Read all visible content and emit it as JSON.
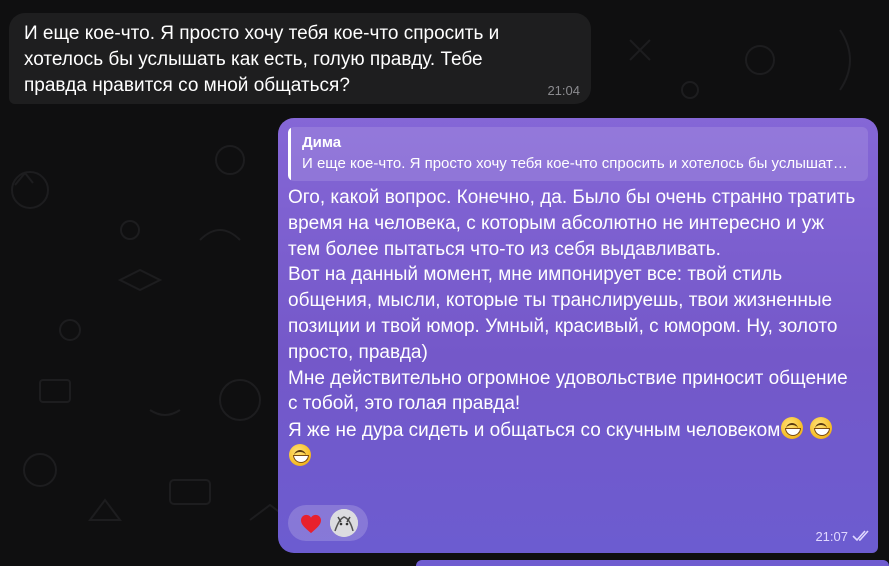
{
  "incoming": {
    "text": "И еще кое-что. Я просто хочу тебя кое-что спросить и хотелось бы услышать как есть, голую правду. Тебе правда нравится со мной общаться?",
    "time": "21:04"
  },
  "outgoing": {
    "reply_name": "Дима",
    "reply_text": "И еще кое-что. Я просто хочу тебя кое-что спросить и хотелось бы услышать как есть, голую правду. Тебе правда нравится со мной общаться?",
    "paragraphs": [
      "Ого, какой вопрос. Конечно, да. Было бы очень странно тратить время на человека, с которым абсолютно не интересно и уж тем более пытаться что-то из себя выдавливать.",
      "Вот на данный момент, мне импонирует все: твой стиль общения, мысли, которые ты транслируешь, твои жизненные позиции и твой юмор. Умный, красивый, с юмором. Ну, золото просто, правда)",
      "Мне действительно огромное удовольствие приносит общение с тобой, это голая правда!"
    ],
    "last_line": "Я же не дура сидеть и общаться со скучным человеком",
    "time": "21:07",
    "reactions": [
      "heart-icon",
      "avatar"
    ],
    "emoji": "grinning-face-icon"
  },
  "colors": {
    "background": "#0f0f10",
    "incoming_bubble": "#1e1e1f",
    "outgoing_bubble": "#7b5fd1"
  }
}
